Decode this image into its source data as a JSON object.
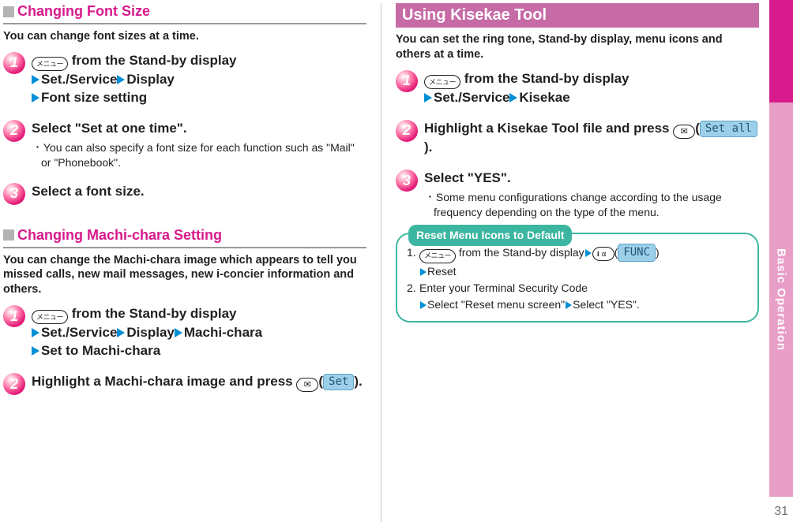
{
  "sidebar": {
    "label": "Basic Operation"
  },
  "pageNumber": "31",
  "left": {
    "section1": {
      "title": "Changing Font Size",
      "intro": "You can change font sizes at a time.",
      "steps": [
        {
          "num": "1",
          "line1_after_icon": " from the Stand-by display",
          "chain": [
            "Set./Service",
            "Display",
            "Font size setting"
          ]
        },
        {
          "num": "2",
          "line1": "Select \"Set at one time\".",
          "note": "You can also specify a font size for each function such as \"Mail\" or \"Phonebook\"."
        },
        {
          "num": "3",
          "line1": "Select a font size."
        }
      ]
    },
    "section2": {
      "title": "Changing Machi-chara Setting",
      "intro": "You can change the Machi-chara image which appears to tell you missed calls, new mail messages, new i-concier information and others.",
      "steps": [
        {
          "num": "1",
          "line1_after_icon": " from the Stand-by display",
          "chain": [
            "Set./Service",
            "Display",
            "Machi-chara",
            "Set to Machi-chara"
          ]
        },
        {
          "num": "2",
          "line1_pre": "Highlight a Machi-chara image and press ",
          "pill": "Set",
          "line1_post": "."
        }
      ]
    }
  },
  "right": {
    "title": "Using Kisekae Tool",
    "intro": "You can set the ring tone, Stand-by display, menu icons and others at a time.",
    "steps": [
      {
        "num": "1",
        "line1_after_icon": " from the Stand-by display",
        "chain": [
          "Set./Service",
          "Kisekae"
        ]
      },
      {
        "num": "2",
        "line1_pre": "Highlight a Kisekae Tool file and press ",
        "pill": "Set all",
        "line1_post": "."
      },
      {
        "num": "3",
        "line1": "Select \"YES\".",
        "note": "Some menu configurations change according to the usage frequency depending on the type of the menu."
      }
    ],
    "infobox": {
      "tab": "Reset Menu Icons to Default",
      "items": [
        {
          "num": "1.",
          "after_icon": " from the Stand-by display",
          "func_pill": "FUNC",
          "line2": "Reset"
        },
        {
          "num": "2.",
          "line1": "Enter your Terminal Security Code",
          "chain": [
            "Select \"Reset menu screen\"",
            "Select \"YES\"."
          ]
        }
      ]
    }
  },
  "icons": {
    "menu_label": "メニュー"
  }
}
